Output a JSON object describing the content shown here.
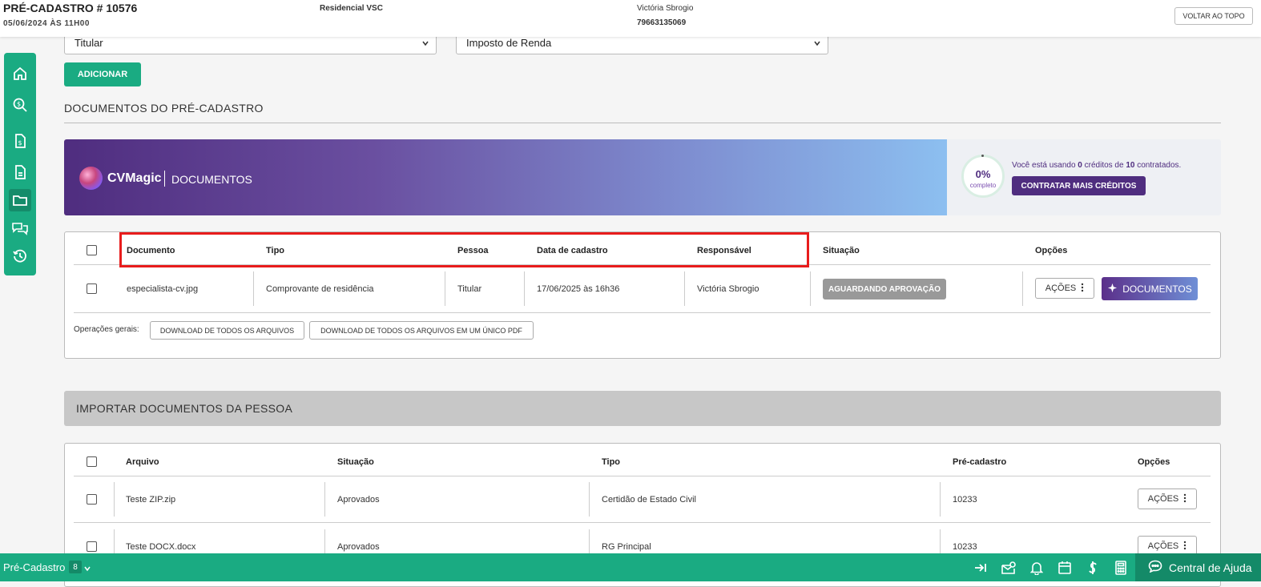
{
  "header": {
    "title": "PRÉ-CADASTRO # 10576",
    "datetime": "05/06/2024 ÀS 11H00",
    "empreendimento": "Residencial VSC",
    "cliente": "Victória Sbrogio",
    "cpf": "79663135069",
    "back_to_top": "VOLTAR AO TOPO"
  },
  "sidebar": {
    "items": [
      "home-icon",
      "search-money-icon",
      "document-money-icon",
      "document-icon",
      "folder-icon",
      "chat-icon",
      "history-icon"
    ],
    "active_index": 4
  },
  "form": {
    "pessoa_select": "Titular",
    "tipo_select": "Imposto de Renda",
    "add_button": "ADICIONAR"
  },
  "documents_section": {
    "title": "DOCUMENTOS DO PRÉ-CADASTRO"
  },
  "cvmagic": {
    "brand": "CVMagic",
    "label": "DOCUMENTOS",
    "progress_percent": "0%",
    "progress_label": "completo",
    "progress_value": 0,
    "credits_prefix": "Você está usando ",
    "credits_used": "0",
    "credits_mid": " créditos de ",
    "credits_total": "10",
    "credits_suffix": " contratados.",
    "buy_button": "CONTRATAR MAIS CRÉDITOS"
  },
  "docs_table": {
    "columns": [
      "Documento",
      "Tipo",
      "Pessoa",
      "Data de cadastro",
      "Responsável",
      "Situação",
      "Opções"
    ],
    "rows": [
      {
        "documento": "especialista-cv.jpg",
        "tipo": "Comprovante de residência",
        "pessoa": "Titular",
        "data": "17/06/2025 às 16h36",
        "responsavel": "Victória Sbrogio",
        "situacao": "AGUARDANDO APROVAÇÃO",
        "acoes": "AÇÕES",
        "documentos": "DOCUMENTOS"
      }
    ],
    "general_ops_label": "Operações gerais:",
    "download_all": "DOWNLOAD DE TODOS OS ARQUIVOS",
    "download_pdf": "DOWNLOAD DE TODOS OS ARQUIVOS EM UM ÚNICO PDF"
  },
  "import_section": {
    "title": "IMPORTAR DOCUMENTOS DA PESSOA",
    "columns": [
      "Arquivo",
      "Situação",
      "Tipo",
      "Pré-cadastro",
      "Opções"
    ],
    "rows": [
      {
        "arquivo": "Teste ZIP.zip",
        "situacao": "Aprovados",
        "tipo": "Certidão de Estado Civil",
        "pre_cadastro": "10233",
        "acoes": "AÇÕES"
      },
      {
        "arquivo": "Teste DOCX.docx",
        "situacao": "Aprovados",
        "tipo": "RG Principal",
        "pre_cadastro": "10233",
        "acoes": "AÇÕES"
      }
    ]
  },
  "footer": {
    "module": "Pré-Cadastro",
    "count": "8",
    "icons": [
      "collapse-right-icon",
      "mail-notification-icon",
      "bell-icon",
      "calendar-icon",
      "dollar-icon",
      "calculator-icon"
    ],
    "help": "Central de Ajuda"
  },
  "colors": {
    "primary": "#1aab82",
    "brand_purple": "#4f2d7f",
    "highlight_box": "#e81c1c"
  }
}
